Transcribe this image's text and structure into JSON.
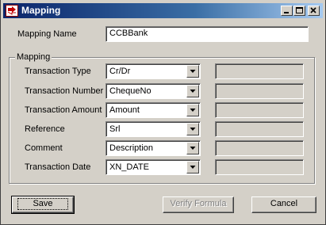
{
  "window": {
    "title": "Mapping"
  },
  "mapping_name": {
    "label": "Mapping Name",
    "value": "CCBBank"
  },
  "group": {
    "title": "Mapping",
    "rows": [
      {
        "label": "Transaction Type",
        "value": "Cr/Dr"
      },
      {
        "label": "Transaction Number",
        "value": "ChequeNo"
      },
      {
        "label": "Transaction Amount",
        "value": "Amount"
      },
      {
        "label": "Reference",
        "value": "Srl"
      },
      {
        "label": "Comment",
        "value": "Description"
      },
      {
        "label": "Transaction Date",
        "value": "XN_DATE"
      }
    ]
  },
  "buttons": {
    "save": "Save",
    "verify": "Verify Formula",
    "cancel": "Cancel"
  }
}
